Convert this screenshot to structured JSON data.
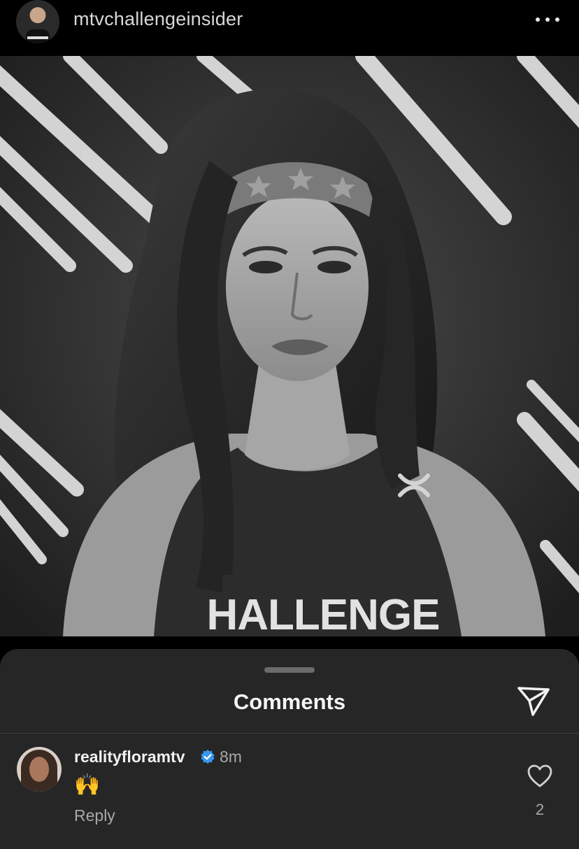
{
  "header": {
    "username": "mtvchallengeinsider",
    "avatar_icon": "profile-avatar",
    "more_icon": "more-horizontal-icon"
  },
  "photo": {
    "shirt_text": "HALLENGE",
    "brand_icon": "under-armour-logo"
  },
  "comments_sheet": {
    "title": "Comments",
    "share_icon": "send-paper-plane-icon",
    "comments": [
      {
        "username": "realityfloramtv",
        "verified": true,
        "time": "8m",
        "text": "🙌",
        "reply_label": "Reply",
        "like_count": "2"
      }
    ]
  },
  "colors": {
    "background": "#000000",
    "sheet": "#262626",
    "muted_text": "#a8a8a8",
    "verified_blue": "#3897f0"
  }
}
